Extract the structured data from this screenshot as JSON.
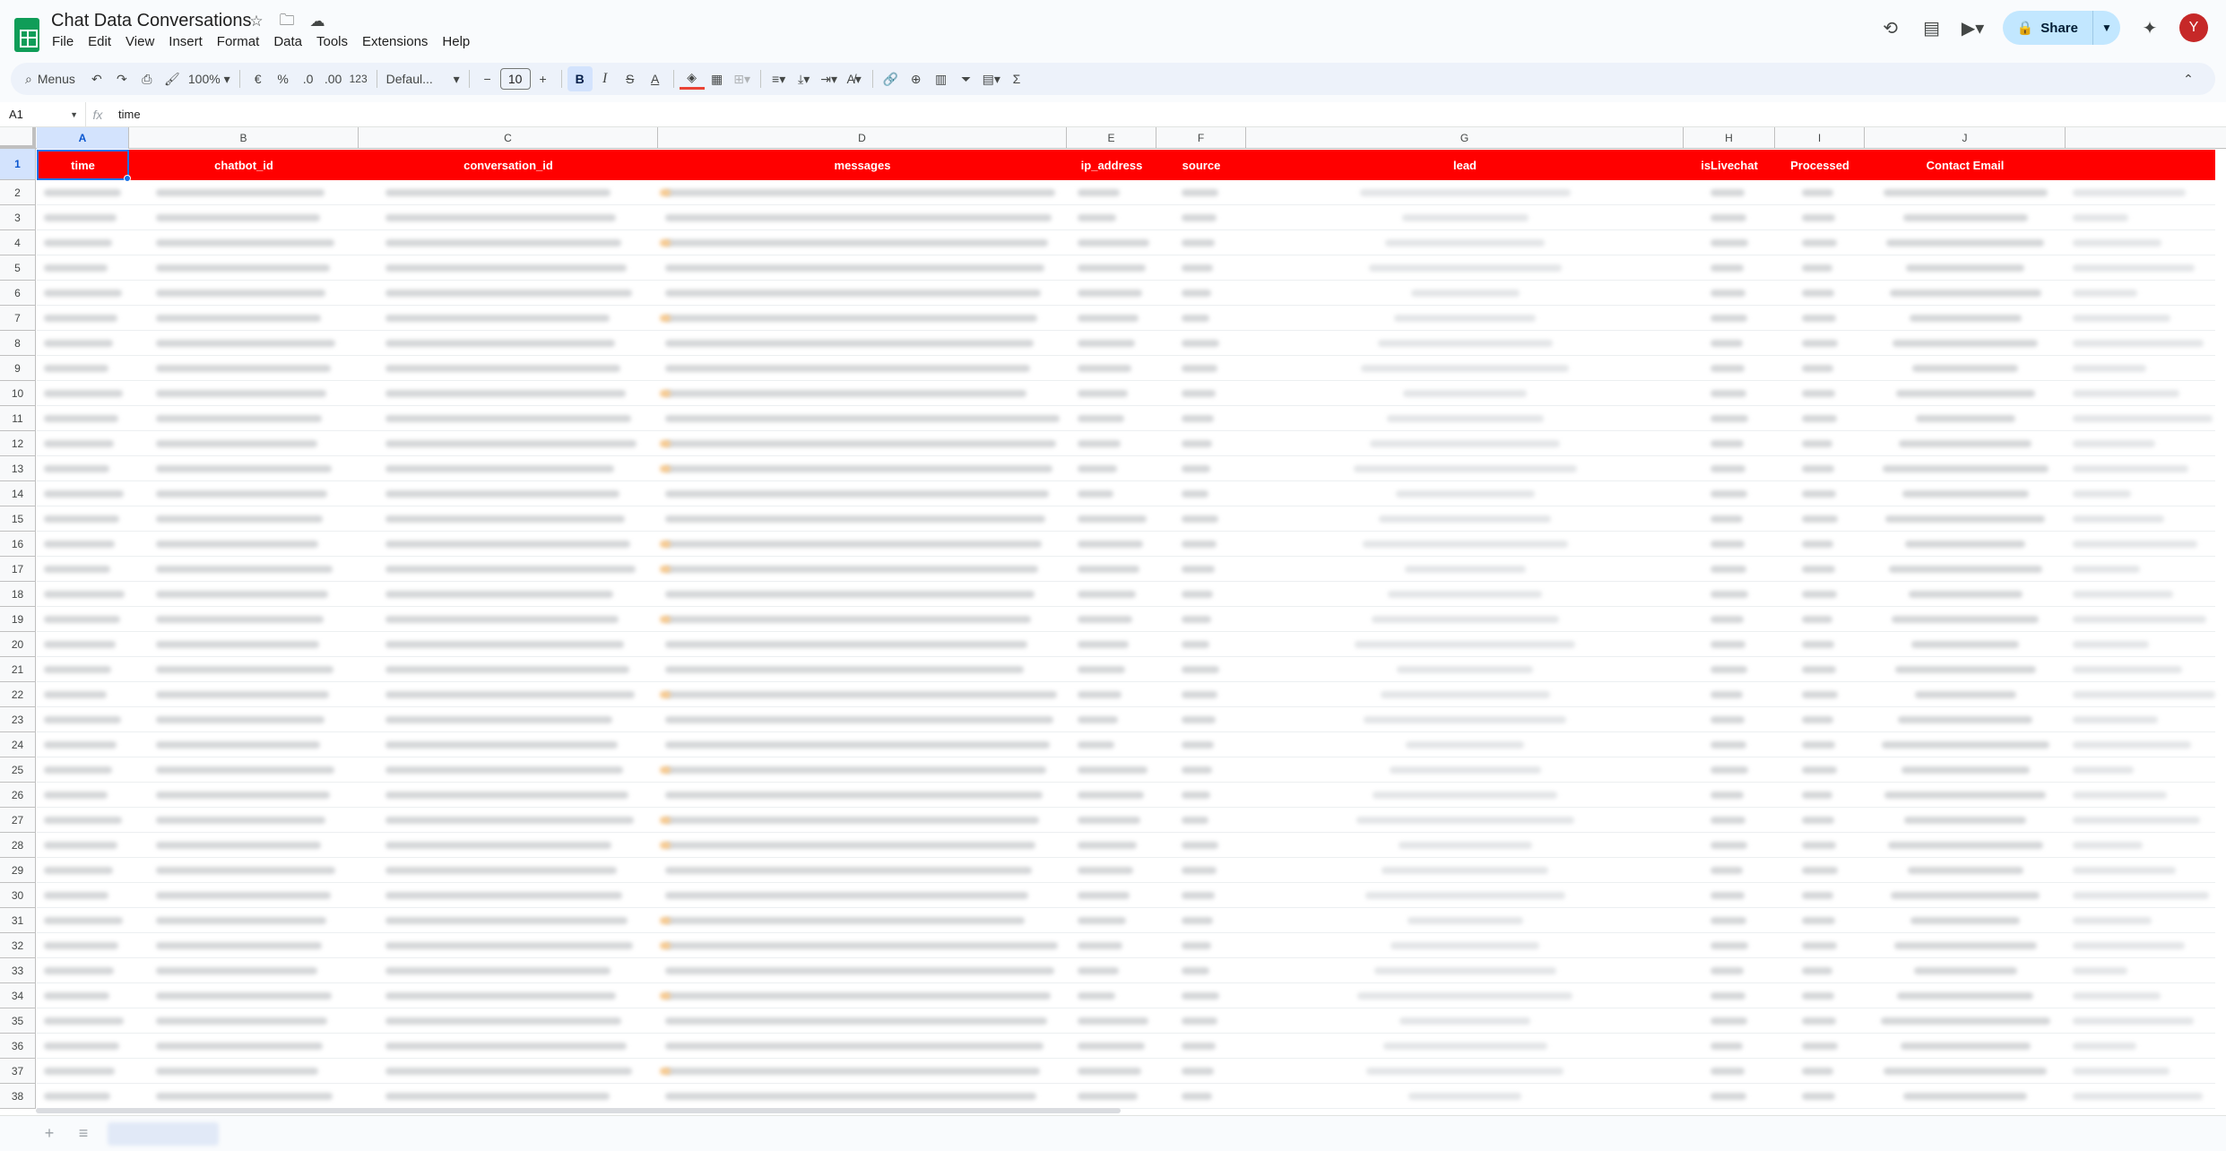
{
  "doc": {
    "title": "Chat Data Conversations",
    "avatar_letter": "Y",
    "share_label": "Share"
  },
  "menu": [
    "File",
    "Edit",
    "View",
    "Insert",
    "Format",
    "Data",
    "Tools",
    "Extensions",
    "Help"
  ],
  "toolbar": {
    "search_label": "Menus",
    "zoom": "100%",
    "currency": "€",
    "percent": "%",
    "dec_decrease": ".0",
    "dec_increase": ".00",
    "number_format": "123",
    "font": "Defaul...",
    "font_size": "10",
    "bold": "B",
    "italic": "I",
    "strike": "S",
    "text_color": "A",
    "sigma": "Σ"
  },
  "formula_bar": {
    "cell_ref": "A1",
    "fx": "fx",
    "value": "time"
  },
  "columns": [
    "A",
    "B",
    "C",
    "D",
    "E",
    "F",
    "G",
    "H",
    "I",
    "J"
  ],
  "headers": [
    "time",
    "chatbot_id",
    "conversation_id",
    "messages",
    "ip_address",
    "source",
    "lead",
    "isLivechat",
    "Processed",
    "Contact Email"
  ],
  "rows": [
    "1",
    "2",
    "3",
    "4",
    "5",
    "6",
    "7",
    "8",
    "9",
    "10",
    "11",
    "12",
    "13",
    "14",
    "15",
    "16",
    "17",
    "18",
    "19",
    "20",
    "21",
    "22",
    "23",
    "24",
    "25",
    "26",
    "27",
    "28",
    "29",
    "30",
    "31",
    "32",
    "33",
    "34",
    "35",
    "36",
    "37",
    "38"
  ],
  "colors": {
    "header_fill": "#ff0000",
    "header_text": "#ffffff",
    "selection": "#1a73e8",
    "share_bg": "#c2e7ff",
    "avatar_bg": "#c62828"
  }
}
